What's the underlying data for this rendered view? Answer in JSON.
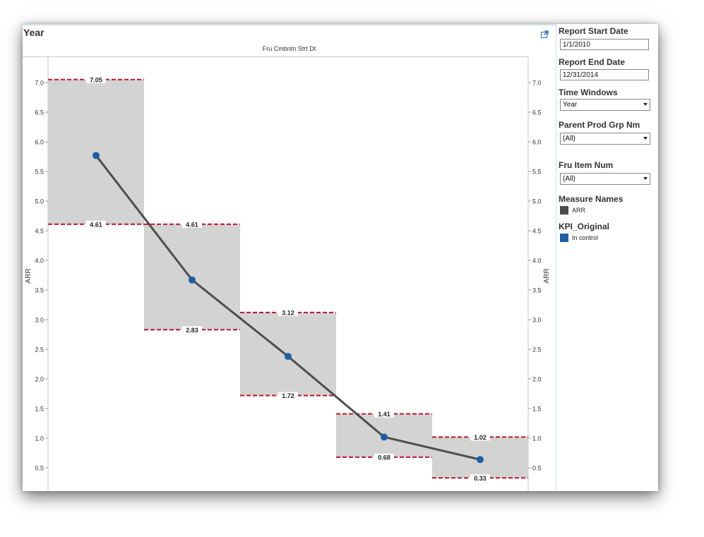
{
  "view": {
    "title": "Year",
    "column_header": "Fru Cmbntn Strt Dt",
    "export_icon": "popout-icon"
  },
  "filters": {
    "report_start_date": {
      "label": "Report Start Date",
      "value": "1/1/2010"
    },
    "report_end_date": {
      "label": "Report End Date",
      "value": "12/31/2014"
    },
    "time_windows": {
      "label": "Time Windows",
      "value": "Year"
    },
    "parent_prod_grp_nm": {
      "label": "Parent Prod Grp Nm",
      "value": "(All)"
    },
    "fru_item_num": {
      "label": "Fru Item Num",
      "value": "(All)"
    }
  },
  "legends": {
    "measure_names": {
      "title": "Measure Names",
      "items": [
        {
          "label": "ARR",
          "color": "#4d4d4d"
        }
      ]
    },
    "kpi_original": {
      "title": "KPI_Original",
      "items": [
        {
          "label": "In control",
          "color": "#1f5fa0"
        }
      ]
    }
  },
  "chart_data": {
    "type": "line",
    "xlabel": "",
    "ylabel": "ARR",
    "ylabel_right": "ARR",
    "ylim": [
      0,
      7.5
    ],
    "yticks": [
      "0.5",
      "1.0",
      "1.5",
      "2.0",
      "2.5",
      "3.0",
      "3.5",
      "4.0",
      "4.5",
      "5.0",
      "5.5",
      "6.0",
      "6.5",
      "7.0"
    ],
    "grid": false,
    "series": [
      {
        "name": "ARR",
        "line_color": "#4d4d4d",
        "marker_color": "#1f5fa0",
        "values": [
          5.77,
          3.67,
          2.38,
          1.02,
          0.64
        ]
      }
    ],
    "control_bands": [
      {
        "upper": 7.05,
        "lower": 4.61,
        "upper_label": "7.05",
        "lower_label": "4.61"
      },
      {
        "upper": 4.61,
        "lower": 2.83,
        "upper_label": "4.61",
        "lower_label": "2.83"
      },
      {
        "upper": 3.12,
        "lower": 1.72,
        "upper_label": "3.12",
        "lower_label": "1.72"
      },
      {
        "upper": 1.41,
        "lower": 0.68,
        "upper_label": "1.41",
        "lower_label": "0.68"
      },
      {
        "upper": 1.02,
        "lower": 0.33,
        "upper_label": "1.02",
        "lower_label": "0.33"
      }
    ],
    "band_fill": "#d3d3d3",
    "limit_line_color": "#b5172a"
  }
}
